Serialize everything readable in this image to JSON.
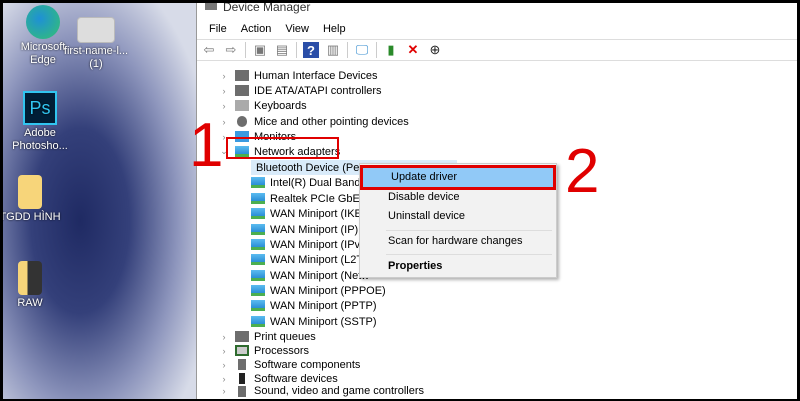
{
  "desktop": {
    "icons": [
      {
        "label": "Microsoft Edge"
      },
      {
        "label": "first-name-l... (1)"
      },
      {
        "label": "Adobe Photosho..."
      },
      {
        "label": "TGDD HÌNH"
      },
      {
        "label": "RAW"
      }
    ]
  },
  "window": {
    "title": "Device Manager",
    "menu": [
      "File",
      "Action",
      "View",
      "Help"
    ]
  },
  "tree": {
    "categories_top": [
      "Human Interface Devices",
      "IDE ATA/ATAPI controllers",
      "Keyboards",
      "Mice and other pointing devices",
      "Monitors"
    ],
    "expanded": "Network adapters",
    "adapters": [
      "Bluetooth Device (Personal Area Network)",
      "Intel(R) Dual Band W",
      "Realtek PCIe GbE Fam",
      "WAN Miniport (IKEv2",
      "WAN Miniport (IP)",
      "WAN Miniport (IPv6)",
      "WAN Miniport (L2TP)",
      "WAN Miniport (Netw",
      "WAN Miniport (PPPOE)",
      "WAN Miniport (PPTP)",
      "WAN Miniport (SSTP)"
    ],
    "categories_bottom": [
      "Print queues",
      "Processors",
      "Software components",
      "Software devices",
      "Sound, video and game controllers"
    ]
  },
  "context_menu": {
    "items": [
      "Update driver",
      "Disable device",
      "Uninstall device",
      "Scan for hardware changes",
      "Properties"
    ]
  },
  "annotations": {
    "step1": "1",
    "step2": "2"
  }
}
